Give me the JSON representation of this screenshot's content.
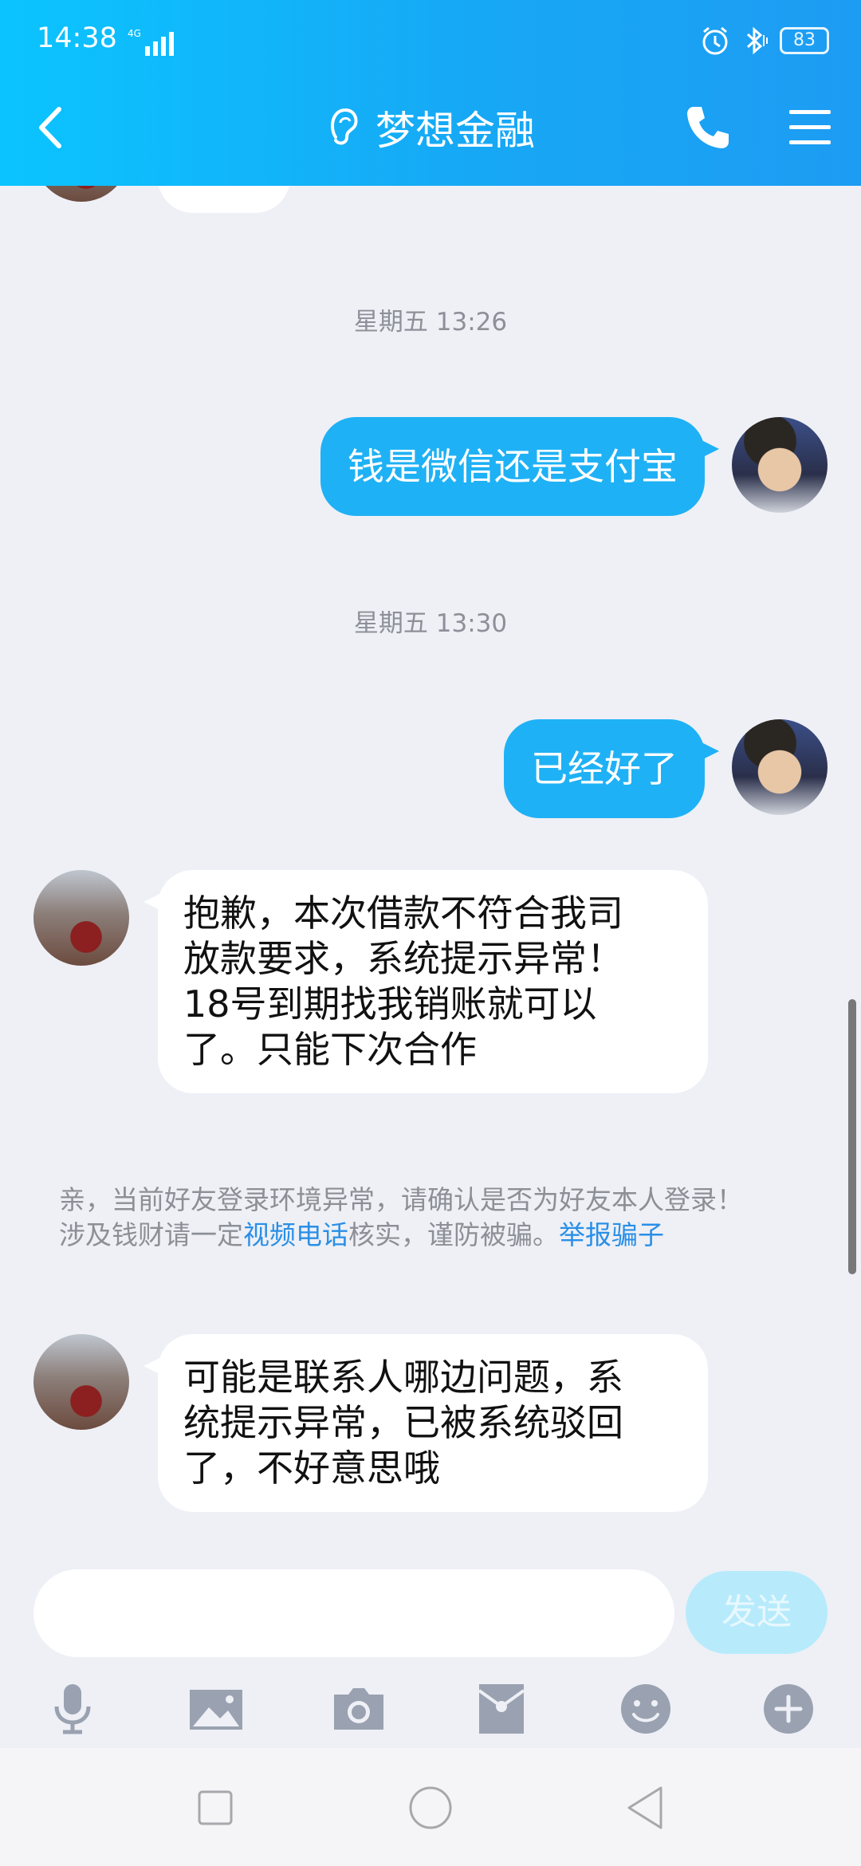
{
  "status_bar": {
    "time": "14:38",
    "network": "4G",
    "battery": "83"
  },
  "header": {
    "title": "梦想金融"
  },
  "chat": {
    "messages": [
      {
        "type": "timestamp",
        "text": "星期五 13:26"
      },
      {
        "type": "outgoing",
        "text": "钱是微信还是支付宝"
      },
      {
        "type": "timestamp",
        "text": "星期五 13:30"
      },
      {
        "type": "outgoing",
        "text": "已经好了"
      },
      {
        "type": "incoming",
        "lines": [
          "抱歉，本次借款不符合我司",
          "放款要求，系统提示异常！",
          "18号到期找我销账就可以",
          "了。只能下次合作"
        ]
      },
      {
        "type": "incoming",
        "lines": [
          "可能是联系人哪边问题，系",
          "统提示异常，已被系统驳回",
          "了，不好意思哦"
        ]
      }
    ],
    "notice": {
      "line1": "亲，当前好友登录环境异常，请确认是否为好友本人登录！",
      "line2_prefix": "涉及钱财请一定",
      "link_video": "视频电话",
      "line2_mid": "核实，谨防被骗。",
      "link_report": "举报骗子"
    }
  },
  "input": {
    "placeholder": "",
    "send_label": "发送"
  },
  "colors": {
    "header_start": "#0bc4ff",
    "header_end": "#1d9cf3",
    "outgoing_bubble": "#1fb1f5",
    "link": "#2a8fe6",
    "send_disabled": "#b7ebfb"
  },
  "toolbar_icons": [
    "microphone-icon",
    "image-icon",
    "camera-icon",
    "red-packet-icon",
    "emoji-icon",
    "plus-icon"
  ]
}
